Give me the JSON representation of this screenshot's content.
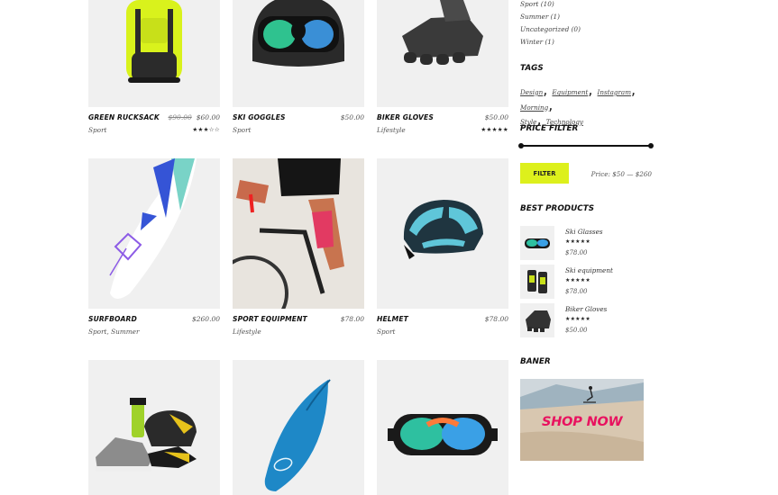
{
  "products": [
    {
      "name": "Green Rucksack",
      "old_price": "$90.00",
      "price": "$60.00",
      "category": "Sport",
      "stars": "★★★☆☆",
      "thumb": "rucksack"
    },
    {
      "name": "Ski Goggles",
      "old_price": "",
      "price": "$50.00",
      "category": "Sport",
      "stars": "",
      "thumb": "helmet-goggles"
    },
    {
      "name": "Biker Gloves",
      "old_price": "",
      "price": "$50.00",
      "category": "Lifestyle",
      "stars": "★★★★★",
      "thumb": "gloves"
    },
    {
      "name": "Surfboard",
      "old_price": "",
      "price": "$260.00",
      "category": "Sport, Summer",
      "stars": "",
      "thumb": "surfboard-white"
    },
    {
      "name": "Sport Equipment",
      "old_price": "",
      "price": "$78.00",
      "category": "Lifestyle",
      "stars": "",
      "thumb": "cyclist"
    },
    {
      "name": "Helmet",
      "old_price": "",
      "price": "$78.00",
      "category": "Sport",
      "stars": "",
      "thumb": "bike-helmet"
    },
    {
      "name": "",
      "old_price": "",
      "price": "",
      "category": "",
      "stars": "",
      "thumb": "shoes-helmet"
    },
    {
      "name": "",
      "old_price": "",
      "price": "",
      "category": "",
      "stars": "",
      "thumb": "surfboard-blue"
    },
    {
      "name": "",
      "old_price": "",
      "price": "",
      "category": "",
      "stars": "",
      "thumb": "goggles"
    }
  ],
  "sidebar": {
    "categories": [
      "Sport (10)",
      "Summer (1)",
      "Uncategorized (0)",
      "Winter (1)"
    ],
    "tags_title": "Tags",
    "tags": [
      "Design",
      "Equipment",
      "Instagram",
      "Morning",
      "Style",
      "Technology"
    ],
    "price_filter_title": "Price Filter",
    "filter_button": "Filter",
    "price_range": "Price: $50 — $260",
    "best_products_title": "Best Products",
    "best_products": [
      {
        "name": "Ski Glasses",
        "stars": "★★★★★",
        "price": "$78.00"
      },
      {
        "name": "Ski equipment",
        "stars": "★★★★★",
        "price": "$78.00"
      },
      {
        "name": "Biker Gloves",
        "stars": "★★★★★",
        "price": "$50.00"
      }
    ],
    "banner_title": "Baner",
    "banner_text": "SHOP NOW"
  },
  "colors": {
    "accent": "#ddf01c",
    "banner_text": "#e8125f",
    "thumb_bg": "#f0f0f0"
  }
}
